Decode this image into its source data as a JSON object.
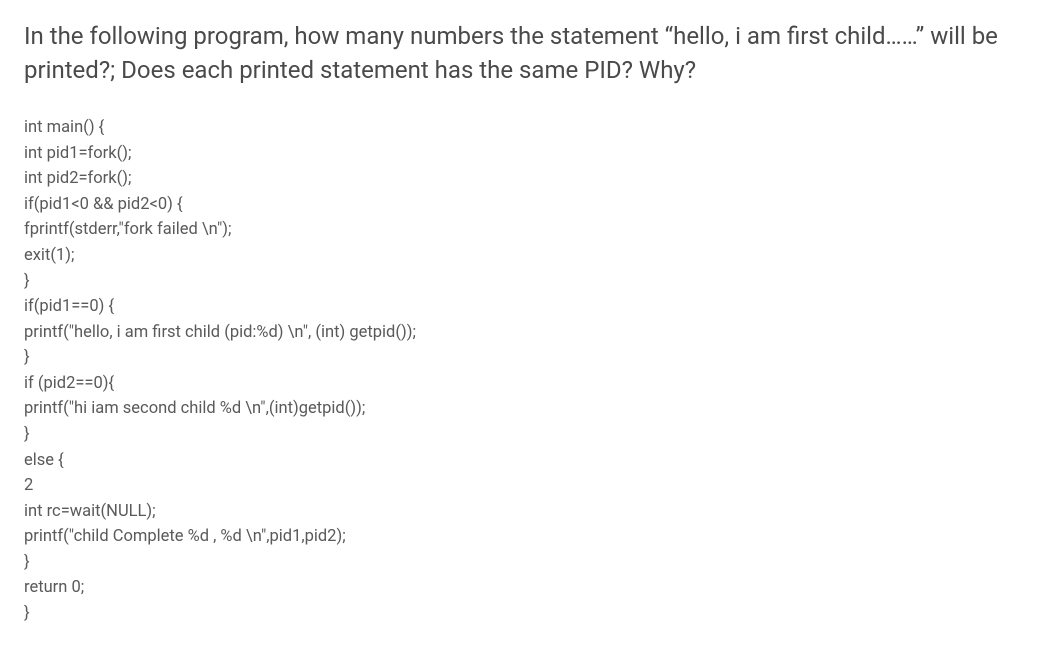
{
  "question": "In the following program, how many numbers the statement “hello, i am first child……” will be printed?; Does each printed statement has the same PID? Why?",
  "code": "int main() {\nint pid1=fork();\nint pid2=fork();\nif(pid1<0 && pid2<0) {\nfprintf(stderr,\"fork failed \\n\");\nexit(1);\n}\nif(pid1==0) {\nprintf(\"hello, i am first child (pid:%d) \\n\", (int) getpid());\n}\nif (pid2==0){\nprintf(\"hi iam second child %d \\n\",(int)getpid());\n}\nelse {\n2\nint rc=wait(NULL);\nprintf(\"child Complete %d , %d \\n\",pid1,pid2);\n}\nreturn 0;\n}"
}
